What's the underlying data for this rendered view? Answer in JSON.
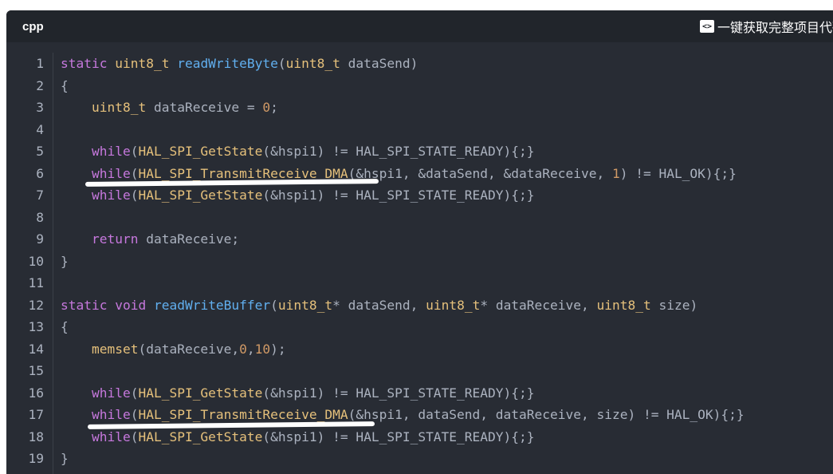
{
  "header": {
    "language": "cpp",
    "copy_label": "一键获取完整项目代码",
    "copy_icon": "code-icon"
  },
  "code": {
    "line_numbers": [
      "1",
      "2",
      "3",
      "4",
      "5",
      "6",
      "7",
      "8",
      "9",
      "10",
      "11",
      "12",
      "13",
      "14",
      "15",
      "16",
      "17",
      "18",
      "19"
    ],
    "lines": [
      [
        {
          "c": "k",
          "v": "static "
        },
        {
          "c": "t",
          "v": "uint8_t "
        },
        {
          "c": "f",
          "v": "readWriteByte"
        },
        {
          "c": "",
          "v": "("
        },
        {
          "c": "t",
          "v": "uint8_t"
        },
        {
          "c": "",
          "v": " dataSend)"
        }
      ],
      [
        {
          "c": "",
          "v": "{"
        }
      ],
      [
        {
          "c": "",
          "v": "    "
        },
        {
          "c": "t",
          "v": "uint8_t"
        },
        {
          "c": "",
          "v": " dataReceive = "
        },
        {
          "c": "n",
          "v": "0"
        },
        {
          "c": "",
          "v": ";"
        }
      ],
      [],
      [
        {
          "c": "",
          "v": "    "
        },
        {
          "c": "k",
          "v": "while"
        },
        {
          "c": "",
          "v": "("
        },
        {
          "c": "fn",
          "v": "HAL_SPI_GetState"
        },
        {
          "c": "",
          "v": "(&hspi1) != HAL_SPI_STATE_READY){;}"
        }
      ],
      [
        {
          "c": "",
          "v": "    "
        },
        {
          "c": "k",
          "v": "while"
        },
        {
          "c": "",
          "v": "("
        },
        {
          "c": "fn",
          "v": "HAL_SPI_TransmitReceive_DMA"
        },
        {
          "c": "",
          "v": "(&hspi1, &dataSend, &dataReceive, "
        },
        {
          "c": "n",
          "v": "1"
        },
        {
          "c": "",
          "v": ") != HAL_OK){;}"
        }
      ],
      [
        {
          "c": "",
          "v": "    "
        },
        {
          "c": "k",
          "v": "while"
        },
        {
          "c": "",
          "v": "("
        },
        {
          "c": "fn",
          "v": "HAL_SPI_GetState"
        },
        {
          "c": "",
          "v": "(&hspi1) != HAL_SPI_STATE_READY){;}"
        }
      ],
      [],
      [
        {
          "c": "",
          "v": "    "
        },
        {
          "c": "k",
          "v": "return"
        },
        {
          "c": "",
          "v": " dataReceive;"
        }
      ],
      [
        {
          "c": "",
          "v": "}"
        }
      ],
      [],
      [
        {
          "c": "k",
          "v": "static "
        },
        {
          "c": "k",
          "v": "void "
        },
        {
          "c": "f",
          "v": "readWriteBuffer"
        },
        {
          "c": "",
          "v": "("
        },
        {
          "c": "t",
          "v": "uint8_t"
        },
        {
          "c": "",
          "v": "* dataSend, "
        },
        {
          "c": "t",
          "v": "uint8_t"
        },
        {
          "c": "",
          "v": "* dataReceive, "
        },
        {
          "c": "t",
          "v": "uint8_t"
        },
        {
          "c": "",
          "v": " size)"
        }
      ],
      [
        {
          "c": "",
          "v": "{"
        }
      ],
      [
        {
          "c": "",
          "v": "    "
        },
        {
          "c": "fn",
          "v": "memset"
        },
        {
          "c": "",
          "v": "(dataReceive,"
        },
        {
          "c": "n",
          "v": "0"
        },
        {
          "c": "",
          "v": ","
        },
        {
          "c": "n",
          "v": "10"
        },
        {
          "c": "",
          "v": ");"
        }
      ],
      [],
      [
        {
          "c": "",
          "v": "    "
        },
        {
          "c": "k",
          "v": "while"
        },
        {
          "c": "",
          "v": "("
        },
        {
          "c": "fn",
          "v": "HAL_SPI_GetState"
        },
        {
          "c": "",
          "v": "(&hspi1) != HAL_SPI_STATE_READY){;}"
        }
      ],
      [
        {
          "c": "",
          "v": "    "
        },
        {
          "c": "k",
          "v": "while"
        },
        {
          "c": "",
          "v": "("
        },
        {
          "c": "fn",
          "v": "HAL_SPI_TransmitReceive_DMA"
        },
        {
          "c": "",
          "v": "(&hspi1, dataSend, dataReceive, size) != HAL_OK){;}"
        }
      ],
      [
        {
          "c": "",
          "v": "    "
        },
        {
          "c": "k",
          "v": "while"
        },
        {
          "c": "",
          "v": "("
        },
        {
          "c": "fn",
          "v": "HAL_SPI_GetState"
        },
        {
          "c": "",
          "v": "(&hspi1) != HAL_SPI_STATE_READY){;}"
        }
      ],
      [
        {
          "c": "",
          "v": "}"
        }
      ]
    ]
  },
  "annotations": {
    "underline_color": "#ffffff",
    "underlined_lines": [
      6,
      17
    ]
  }
}
